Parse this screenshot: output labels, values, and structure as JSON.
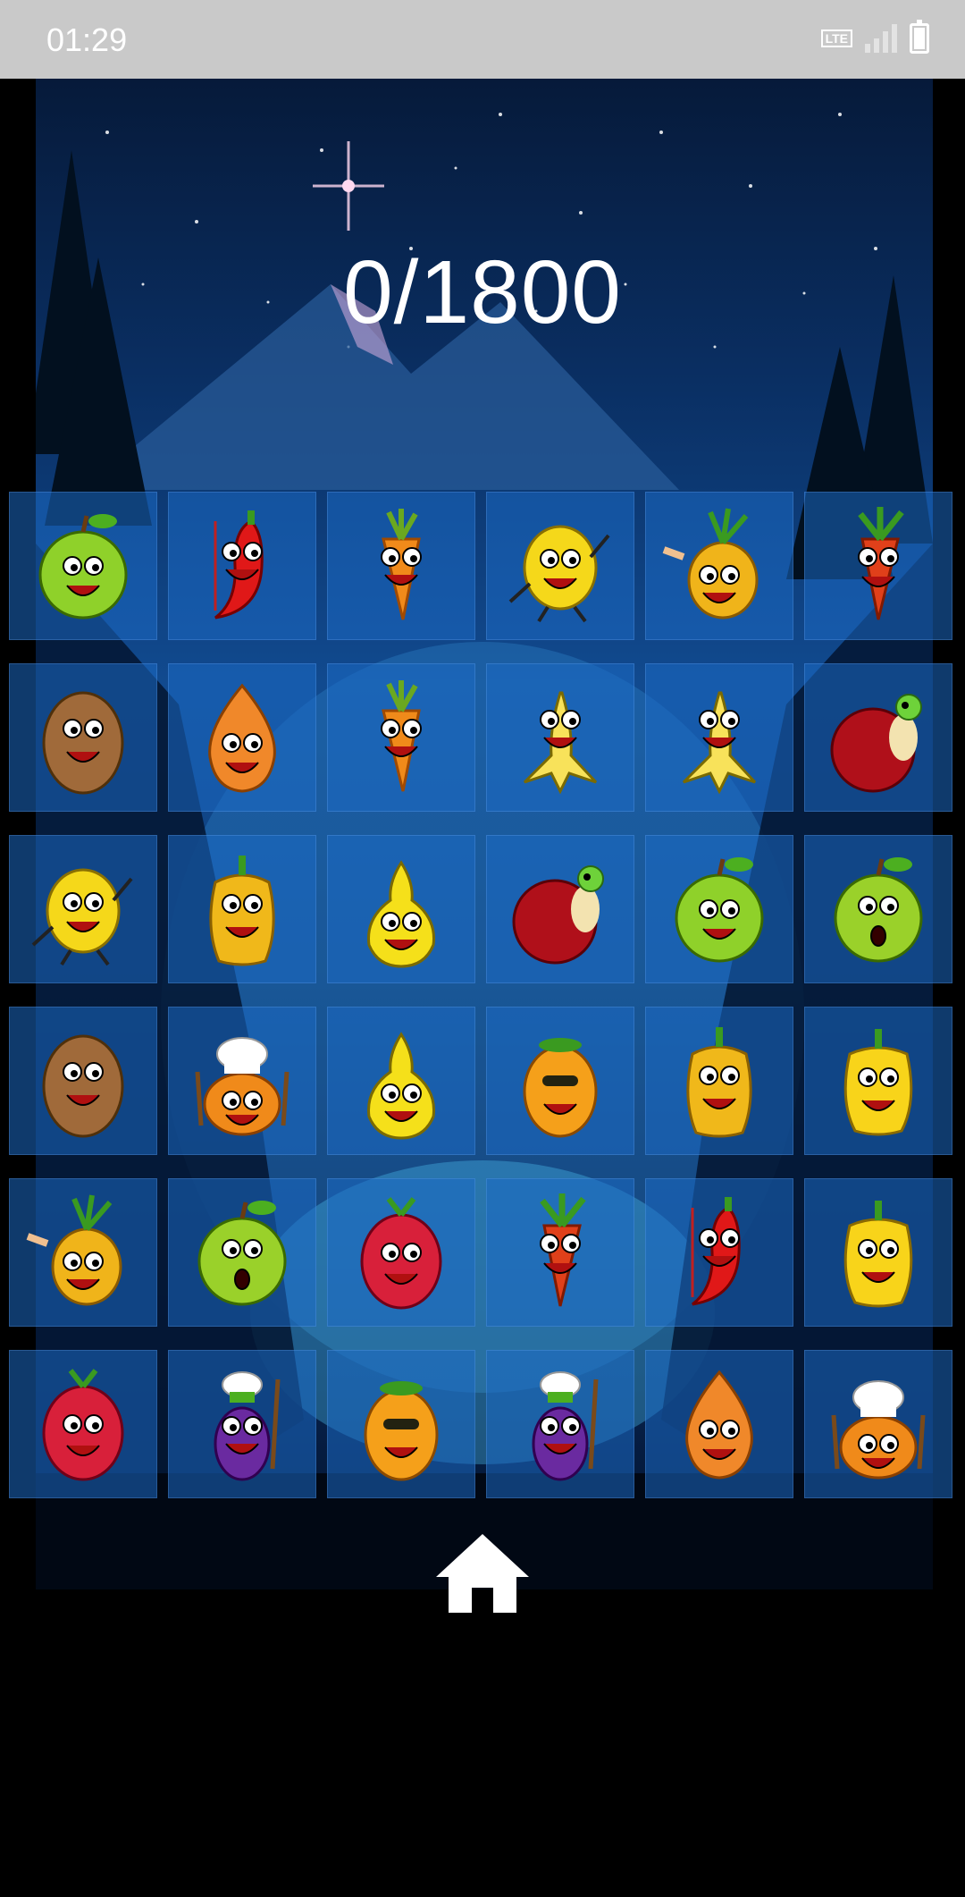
{
  "status_bar": {
    "time": "01:29",
    "network": "LTE",
    "icons": [
      "lte-icon",
      "signal-icon",
      "battery-charging-icon"
    ]
  },
  "score": {
    "text": "0/1800",
    "current": 0,
    "target": 1800
  },
  "board": {
    "rows": 6,
    "cols": 6,
    "cells": [
      [
        "green-apple",
        "red-chili",
        "carrot",
        "lemon-dancer",
        "pineapple",
        "carrot-tomato"
      ],
      [
        "potato",
        "onion",
        "carrot",
        "banana",
        "banana",
        "red-apple-worm"
      ],
      [
        "lemon-dancer",
        "yellow-pepper",
        "pear",
        "red-apple-worm",
        "green-apple",
        "green-apple-surprised"
      ],
      [
        "potato",
        "chef-pumpkin",
        "pear",
        "mango",
        "yellow-pepper",
        "yellow-bell-pepper"
      ],
      [
        "pineapple",
        "green-apple-surprised",
        "raspberry",
        "carrot-tomato",
        "red-chili",
        "yellow-bell-pepper"
      ],
      [
        "raspberry",
        "eggplant-chef",
        "mango",
        "eggplant-chef",
        "onion",
        "chef-pumpkin"
      ]
    ]
  },
  "navigation": {
    "home_icon": "home-icon"
  },
  "colors": {
    "tile": "#1c69c4",
    "background_top": "#061a3a",
    "background_mid": "#114a8f",
    "status_bar": "#c9c9c9"
  }
}
